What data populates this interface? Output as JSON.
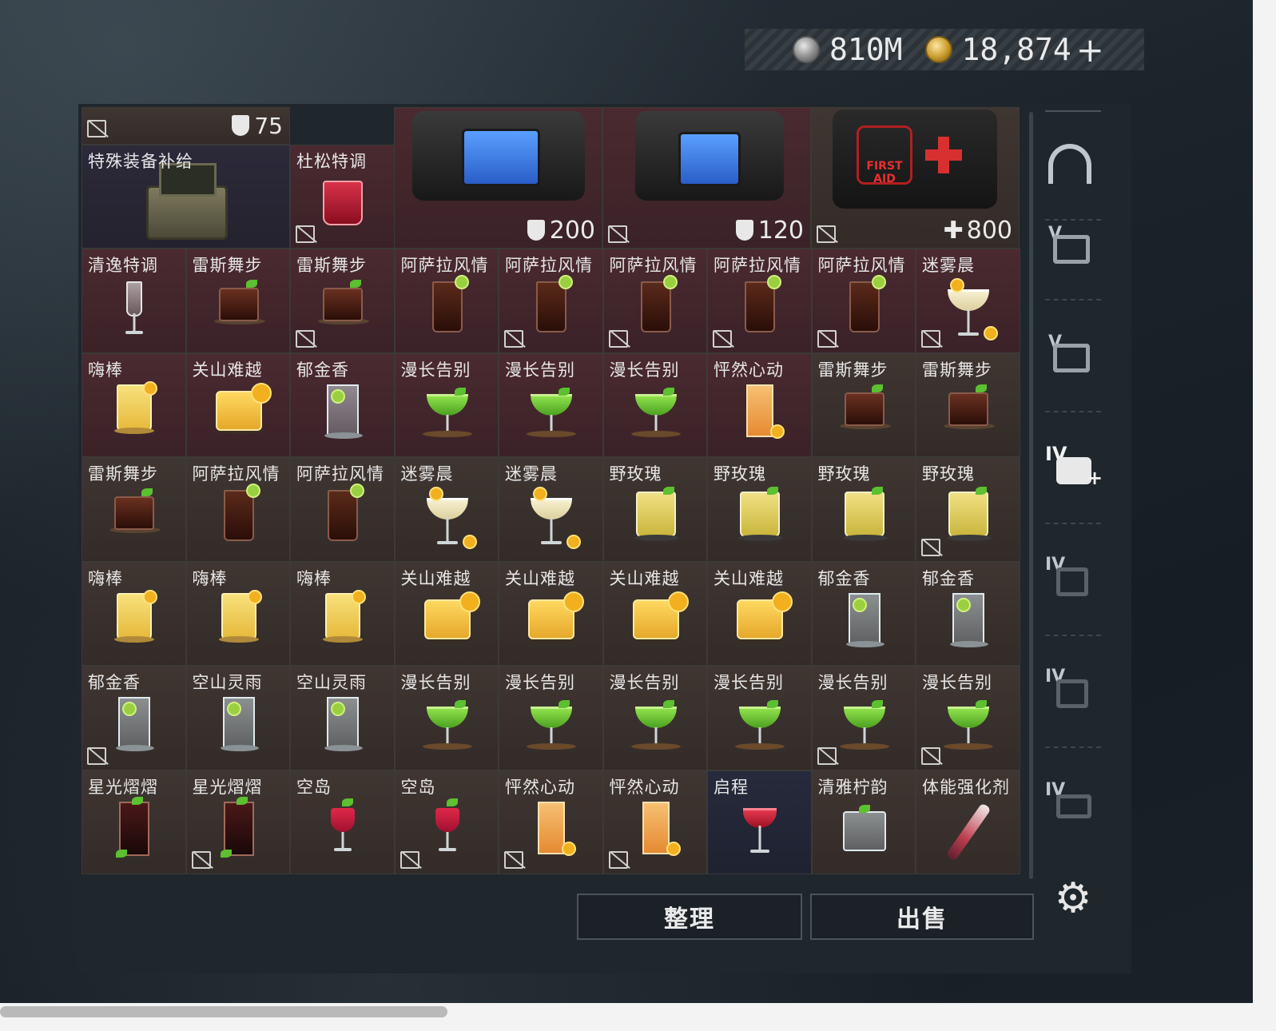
{
  "currency": {
    "coins_value": "810M",
    "bonds_value": "18,874",
    "add_label": "+"
  },
  "buttons": {
    "organize": "整理",
    "sell": "出售"
  },
  "sidebar": {
    "tiers": [
      "IV",
      "IV",
      "IV",
      "IV"
    ],
    "v_labels": [
      "V",
      "V"
    ]
  },
  "top_row": {
    "armor_stat_1": "75",
    "vest_bag_stat": "200",
    "vest_bag2_stat": "120",
    "first_aid_stat": "800",
    "first_aid_text": "FIRST AID"
  },
  "items": [
    {
      "name": "特殊装备补给",
      "type": "case"
    },
    {
      "name": "杜松特调",
      "type": "redglass"
    },
    {
      "name": "清逸特调",
      "type": "flute"
    },
    {
      "name": "雷斯舞步",
      "type": "rockscola"
    },
    {
      "name": "雷斯舞步",
      "type": "rockscola"
    },
    {
      "name": "阿萨拉风情",
      "type": "cola"
    },
    {
      "name": "阿萨拉风情",
      "type": "cola"
    },
    {
      "name": "阿萨拉风情",
      "type": "cola"
    },
    {
      "name": "阿萨拉风情",
      "type": "cola"
    },
    {
      "name": "阿萨拉风情",
      "type": "cola"
    },
    {
      "name": "迷雾晨",
      "type": "pale"
    },
    {
      "name": "嗨棒",
      "type": "yellow"
    },
    {
      "name": "关山难越",
      "type": "rocksyel"
    },
    {
      "name": "郁金香",
      "type": "clear"
    },
    {
      "name": "漫长告别",
      "type": "green"
    },
    {
      "name": "漫长告别",
      "type": "green"
    },
    {
      "name": "漫长告别",
      "type": "green"
    },
    {
      "name": "怦然心动",
      "type": "orange"
    },
    {
      "name": "雷斯舞步",
      "type": "rockscola"
    },
    {
      "name": "雷斯舞步",
      "type": "rockscola"
    },
    {
      "name": "雷斯舞步",
      "type": "rockscola"
    },
    {
      "name": "阿萨拉风情",
      "type": "cola"
    },
    {
      "name": "阿萨拉风情",
      "type": "cola"
    },
    {
      "name": "迷雾晨",
      "type": "pale"
    },
    {
      "name": "迷雾晨",
      "type": "pale"
    },
    {
      "name": "野玫瑰",
      "type": "lemon"
    },
    {
      "name": "野玫瑰",
      "type": "lemon"
    },
    {
      "name": "野玫瑰",
      "type": "lemon"
    },
    {
      "name": "野玫瑰",
      "type": "lemon"
    },
    {
      "name": "嗨棒",
      "type": "yellow"
    },
    {
      "name": "嗨棒",
      "type": "yellow"
    },
    {
      "name": "嗨棒",
      "type": "yellow"
    },
    {
      "name": "关山难越",
      "type": "rocksyel"
    },
    {
      "name": "关山难越",
      "type": "rocksyel"
    },
    {
      "name": "关山难越",
      "type": "rocksyel"
    },
    {
      "name": "关山难越",
      "type": "rocksyel"
    },
    {
      "name": "郁金香",
      "type": "clear"
    },
    {
      "name": "郁金香",
      "type": "clear"
    },
    {
      "name": "郁金香",
      "type": "clear"
    },
    {
      "name": "空山灵雨",
      "type": "clear"
    },
    {
      "name": "空山灵雨",
      "type": "clear"
    },
    {
      "name": "漫长告别",
      "type": "green"
    },
    {
      "name": "漫长告别",
      "type": "green"
    },
    {
      "name": "漫长告别",
      "type": "green"
    },
    {
      "name": "漫长告别",
      "type": "green"
    },
    {
      "name": "漫长告别",
      "type": "green"
    },
    {
      "name": "漫长告别",
      "type": "green"
    },
    {
      "name": "星光熠熠",
      "type": "darktall"
    },
    {
      "name": "星光熠熠",
      "type": "darktall"
    },
    {
      "name": "空岛",
      "type": "pink"
    },
    {
      "name": "空岛",
      "type": "pink"
    },
    {
      "name": "怦然心动",
      "type": "orange"
    },
    {
      "name": "怦然心动",
      "type": "orange"
    },
    {
      "name": "启程",
      "type": "red"
    },
    {
      "name": "清雅柠韵",
      "type": "rocksclear"
    },
    {
      "name": "体能强化剂",
      "type": "syringe"
    }
  ]
}
